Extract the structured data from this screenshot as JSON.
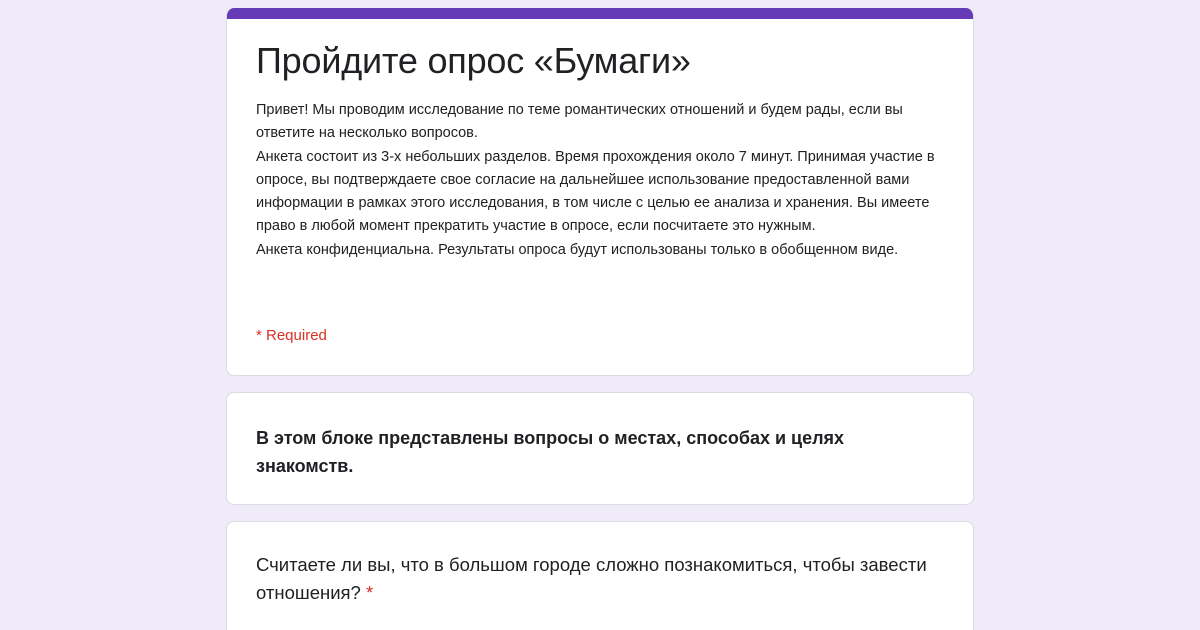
{
  "theme": {
    "accent": "#673ab7",
    "background": "#efebf8",
    "required": "#d93025"
  },
  "form": {
    "title": "Пройдите опрос «Бумаги»",
    "description": "Привет! Мы проводим исследование по теме романтических отношений и будем рады, если вы ответите на несколько вопросов.\nАнкета состоит из 3-х небольших разделов. Время прохождения около 7 минут. Принимая участие в опросе, вы подтверждаете свое согласие на дальнейшее использование предоставленной вами информации в рамках этого исследования, в том числе с целью ее анализа и хранения. Вы имеете право в любой момент прекратить участие в опросе, если посчитаете это нужным.\nАнкета конфиденциальна. Результаты опроса будут использованы только в обобщенном виде.",
    "required_note": "* Required"
  },
  "section": {
    "text": "В этом блоке представлены вопросы о местах, способах и целях знакомств."
  },
  "question": {
    "text": "Считаете ли вы, что в большом городе сложно познакомиться, чтобы завести отношения?",
    "required_marker": "*"
  }
}
